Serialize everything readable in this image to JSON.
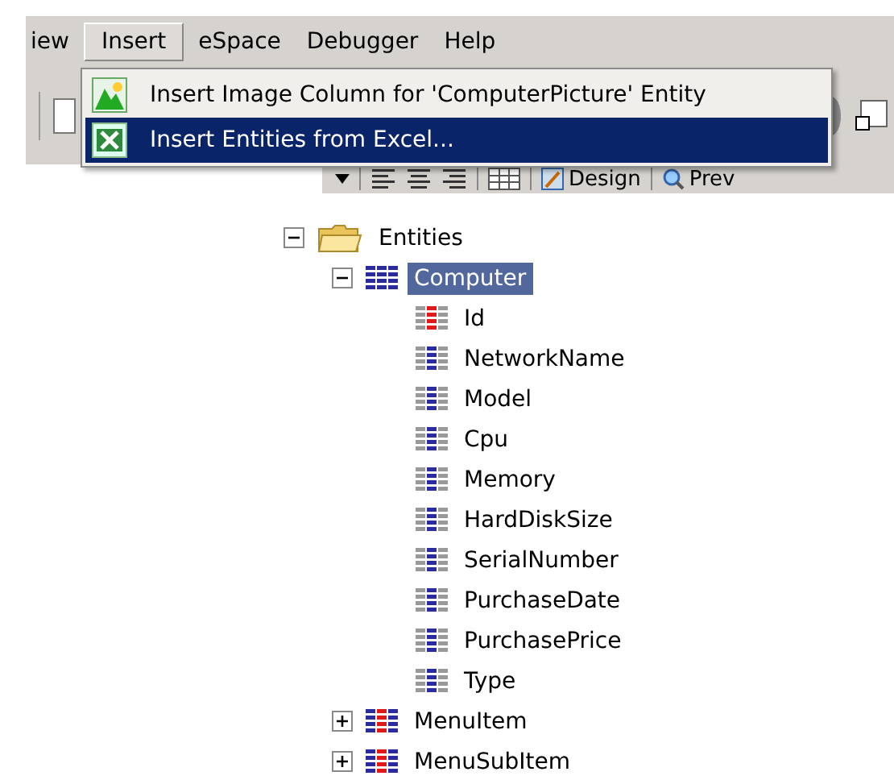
{
  "menubar": [
    {
      "label": "iew",
      "selected": false
    },
    {
      "label": "Insert",
      "selected": true
    },
    {
      "label": "eSpace",
      "selected": false
    },
    {
      "label": "Debugger",
      "selected": false
    },
    {
      "label": "Help",
      "selected": false
    }
  ],
  "insert_menu": [
    {
      "label": "Insert Image Column for 'ComputerPicture' Entity",
      "kind": "image",
      "highlighted": false
    },
    {
      "label": "Insert Entities from Excel...",
      "kind": "excel",
      "highlighted": true
    }
  ],
  "view_toolbar": {
    "design_tab": "Design",
    "preview_tab": "Prev"
  },
  "tree": [
    {
      "label": "Entities",
      "kind": "folder",
      "expanded": true,
      "selected": false,
      "children": [
        {
          "label": "Computer",
          "kind": "entity",
          "expanded": true,
          "selected": true,
          "children": [
            {
              "label": "Id",
              "kind": "key-attribute",
              "selected": false
            },
            {
              "label": "NetworkName",
              "kind": "attribute",
              "selected": false
            },
            {
              "label": "Model",
              "kind": "attribute",
              "selected": false
            },
            {
              "label": "Cpu",
              "kind": "attribute",
              "selected": false
            },
            {
              "label": "Memory",
              "kind": "attribute",
              "selected": false
            },
            {
              "label": "HardDiskSize",
              "kind": "attribute",
              "selected": false
            },
            {
              "label": "SerialNumber",
              "kind": "attribute",
              "selected": false
            },
            {
              "label": "PurchaseDate",
              "kind": "attribute",
              "selected": false
            },
            {
              "label": "PurchasePrice",
              "kind": "attribute",
              "selected": false
            },
            {
              "label": "Type",
              "kind": "attribute",
              "selected": false
            }
          ]
        },
        {
          "label": "MenuItem",
          "kind": "system-entity",
          "expanded": false,
          "selected": false
        },
        {
          "label": "MenuSubItem",
          "kind": "system-entity",
          "expanded": false,
          "selected": false
        }
      ]
    }
  ]
}
